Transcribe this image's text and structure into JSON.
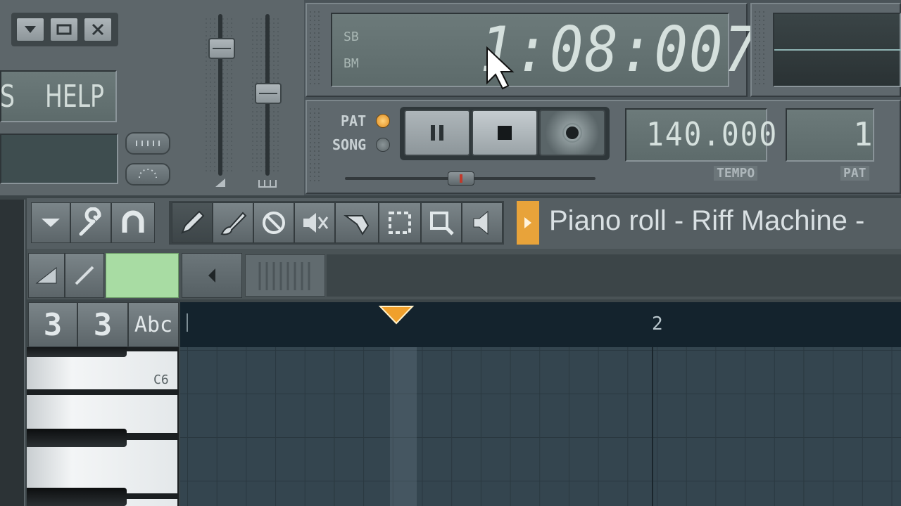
{
  "window_controls": {
    "menu_icon": "dropdown-icon",
    "restore_icon": "restore-icon",
    "close_icon": "close-icon"
  },
  "menu": {
    "partial": "S",
    "help": "HELP"
  },
  "time_display": {
    "sb_label": "SB",
    "bm_label": "BM",
    "value": "1:08:007"
  },
  "mode": {
    "pat_label": "PAT",
    "song_label": "SONG"
  },
  "tempo": {
    "value": "140.000",
    "label": "TEMPO"
  },
  "pattern": {
    "value": "1",
    "label": "PAT"
  },
  "piano_roll": {
    "title": "Piano roll - Riff Machine -"
  },
  "timeline": {
    "bar_2": "2"
  },
  "keys": {
    "c6": "C6"
  },
  "snap": {
    "abc": "Abc"
  },
  "colors": {
    "accent_orange": "#e8a33a",
    "lcd_text": "#c9d6d3",
    "selected_green": "#a8dca3"
  }
}
